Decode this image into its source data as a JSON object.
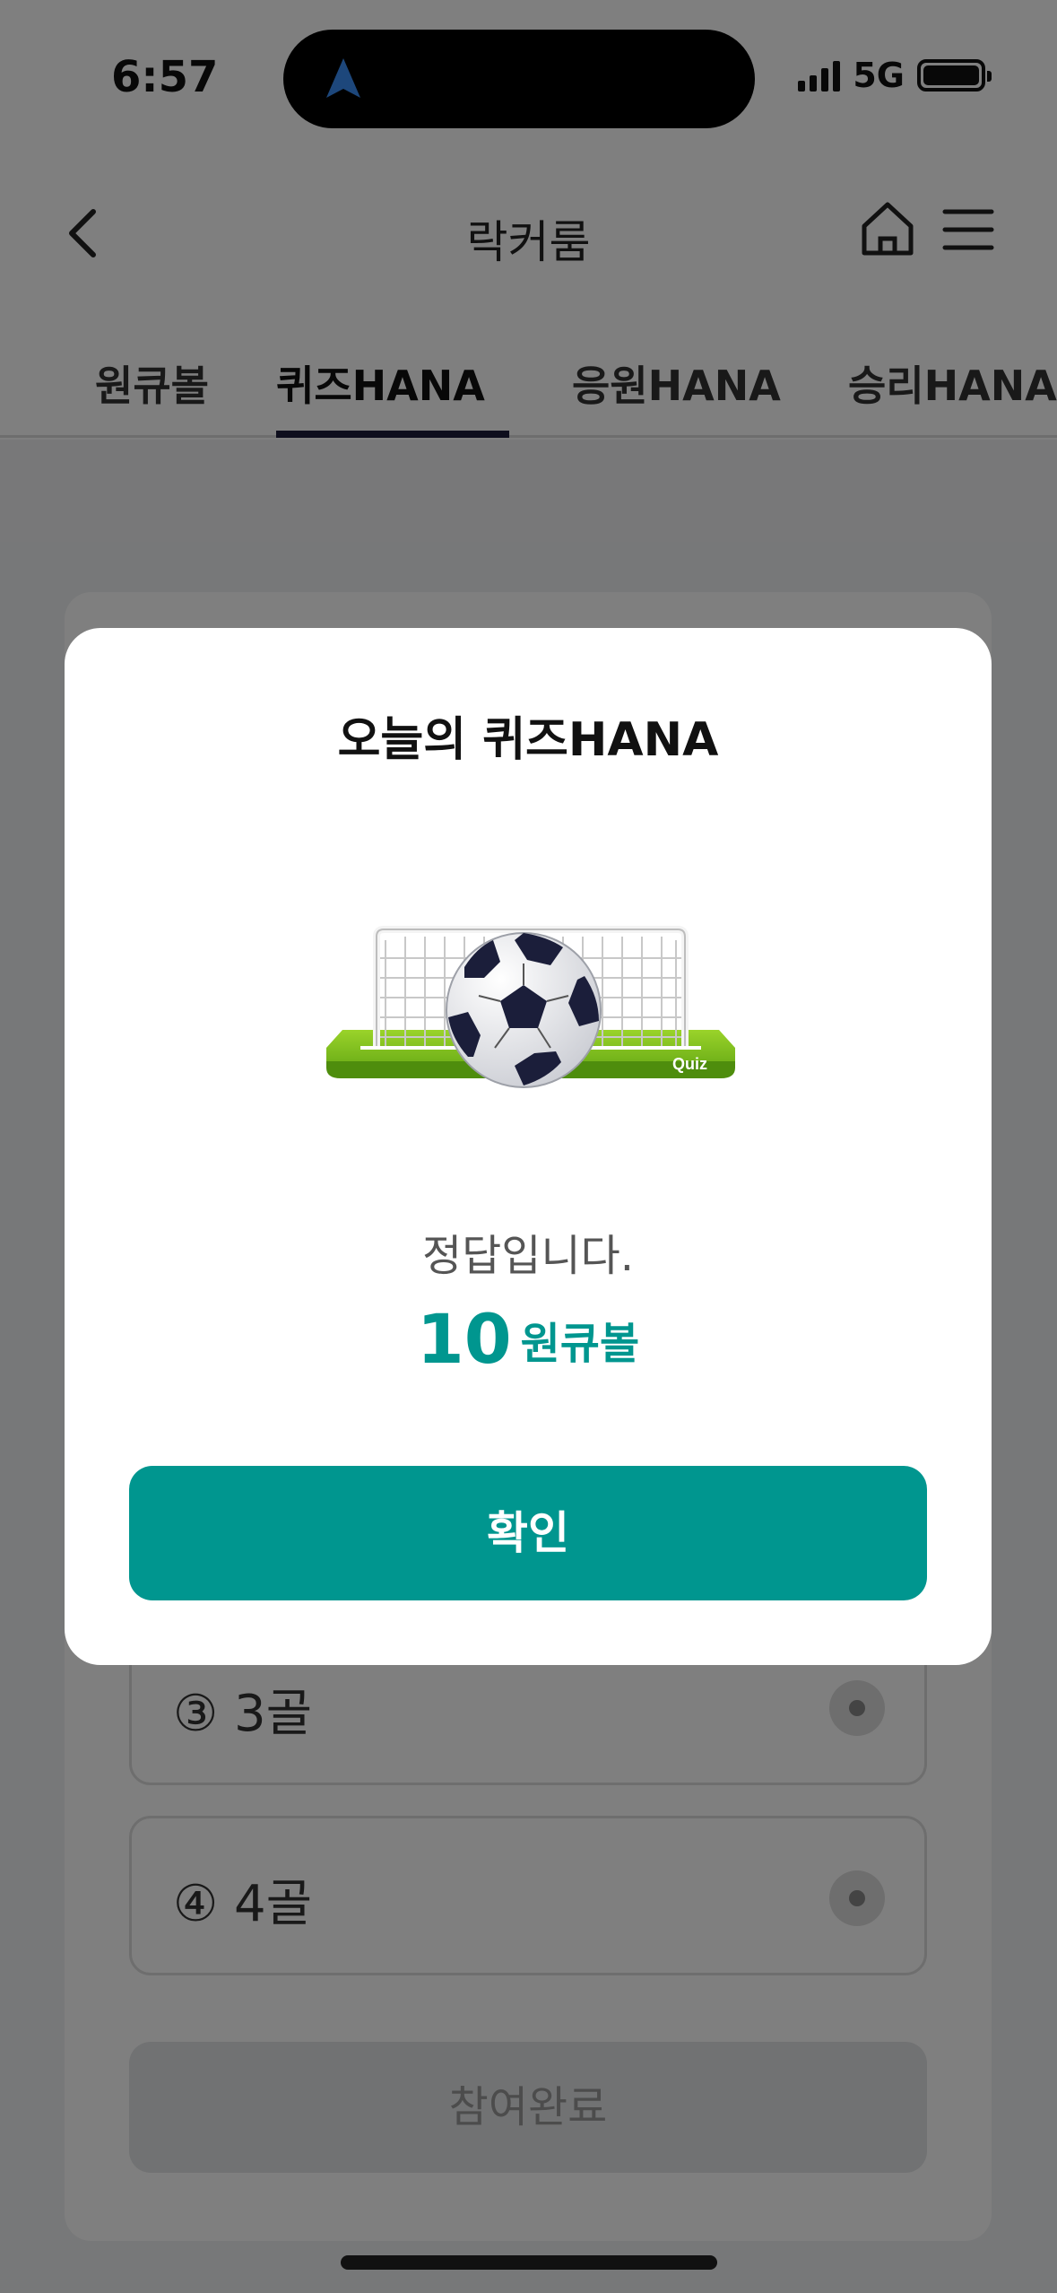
{
  "status_bar": {
    "time": "6:57",
    "network": "5G"
  },
  "header": {
    "title": "락커룸"
  },
  "tabs": [
    {
      "label": "원큐볼",
      "active": false
    },
    {
      "label": "퀴즈HANA",
      "active": true
    },
    {
      "label": "응원HANA",
      "active": false
    },
    {
      "label": "승리HANA",
      "active": false
    }
  ],
  "quiz": {
    "options": [
      {
        "label": "③ 3골"
      },
      {
        "label": "④ 4골"
      }
    ],
    "submit_label": "참여완료"
  },
  "modal": {
    "title": "오늘의 퀴즈HANA",
    "illustration_badge": "Quiz",
    "message": "정답입니다.",
    "reward_amount": "10",
    "reward_unit": "원큐볼",
    "confirm_label": "확인"
  },
  "colors": {
    "accent": "#00968f",
    "tab_indicator": "#1d1d3a",
    "overlay": "rgba(0,0,0,0.5)"
  }
}
